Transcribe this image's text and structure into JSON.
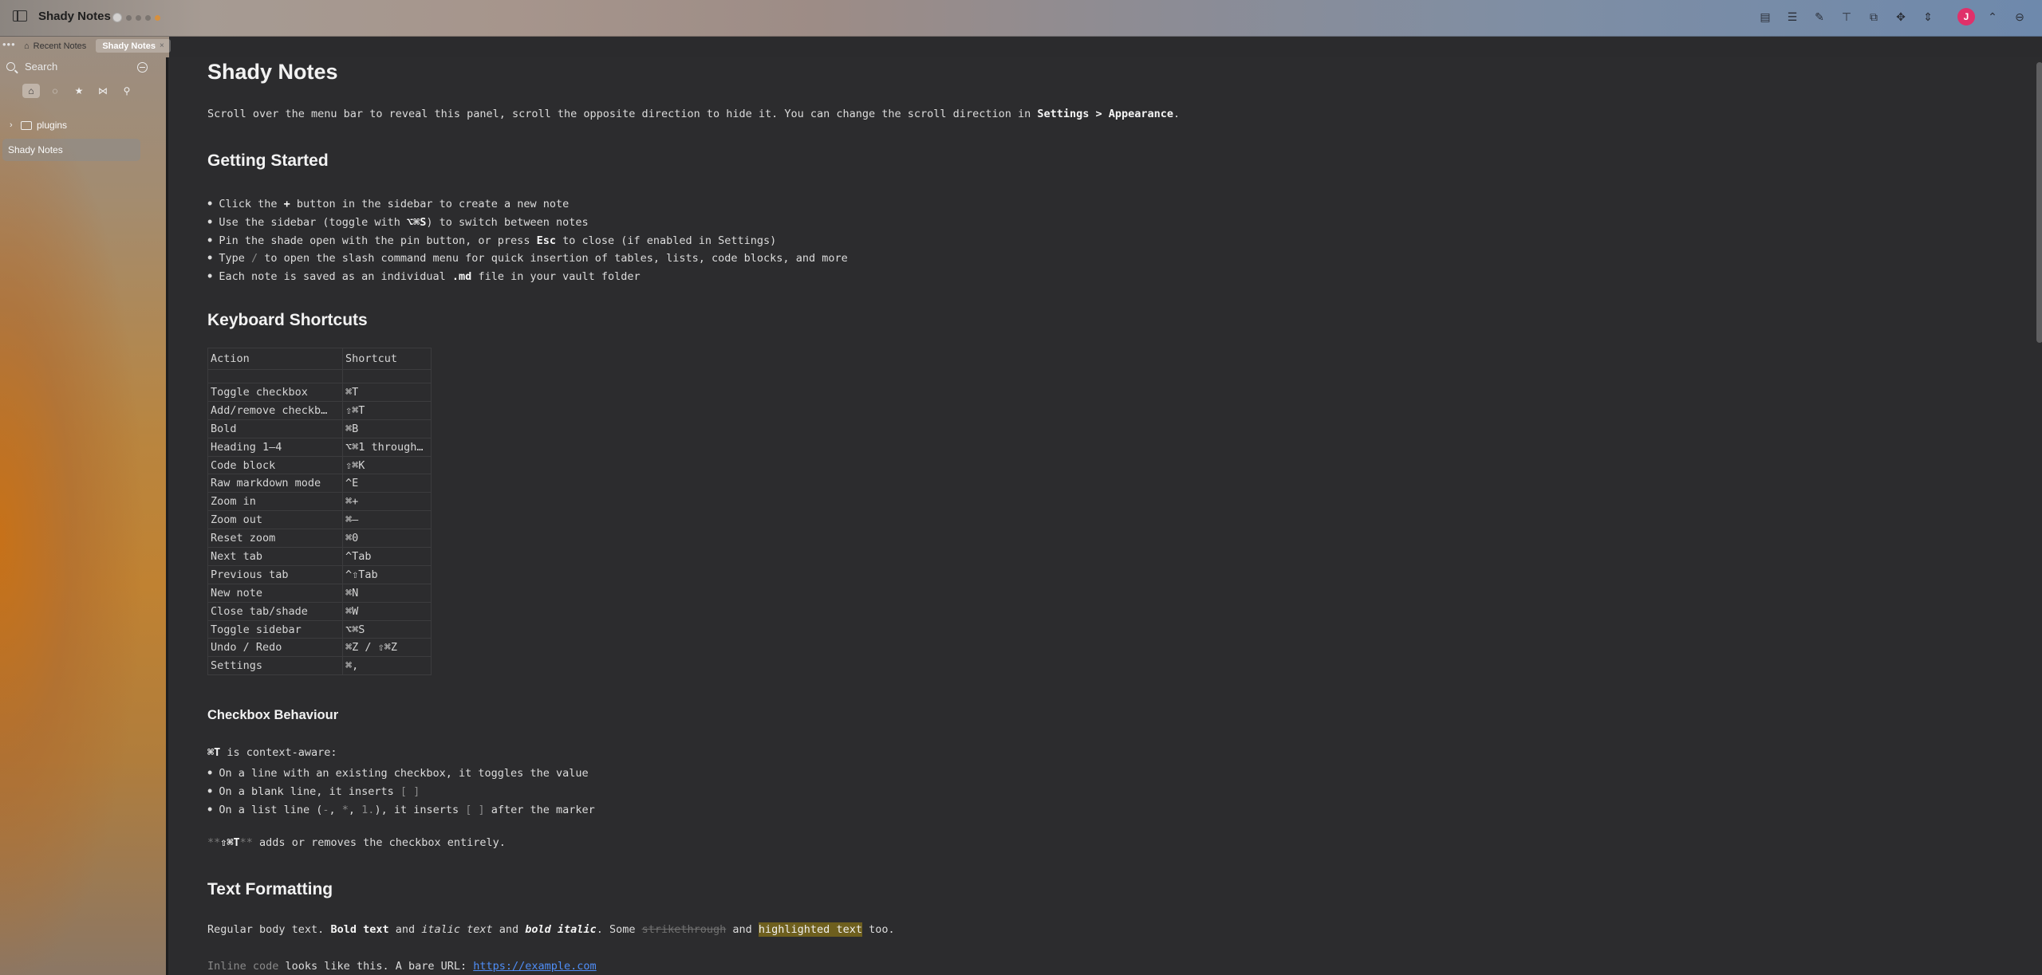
{
  "window": {
    "title": "Shady Notes",
    "toolbar_icons": [
      "note-icon",
      "list-icon",
      "pencil-icon",
      "pin-icon",
      "export-icon",
      "move-icon",
      "expand-icon"
    ],
    "avatar_initial": "J",
    "right_icons": [
      "chevron-up-icon",
      "minus-circle-icon"
    ]
  },
  "tabs": [
    {
      "label": "Recent Notes",
      "active": false
    },
    {
      "label": "Shady Notes",
      "active": true
    }
  ],
  "sidebar": {
    "search_placeholder": "Search",
    "tree": [
      {
        "label": "plugins",
        "type": "folder"
      },
      {
        "label": "Shady Notes",
        "type": "note",
        "selected": true
      }
    ]
  },
  "note": {
    "title": "Shady Notes",
    "intro_pre": "Scroll over the menu bar to reveal this panel, scroll the opposite direction to hide it. You can change the scroll direction in ",
    "intro_bold": "Settings > Appearance",
    "intro_post": ".",
    "getting_started": {
      "heading": "Getting Started",
      "b1_pre": "Click the ",
      "b1_bold": "+",
      "b1_post": " button in the sidebar to create a new note",
      "b2_pre": "Use the sidebar (toggle with ",
      "b2_bold": "⌥⌘S",
      "b2_post": ") to switch between notes",
      "b3_pre": "Pin the shade open with the pin button, or press ",
      "b3_bold": "Esc",
      "b3_post": " to close (if enabled in Settings)",
      "b4_pre": "Type ",
      "b4_code": "/",
      "b4_post": " to open the slash command menu for quick insertion of tables, lists, code blocks, and more",
      "b5_pre": "Each note is saved as an individual ",
      "b5_bold": ".md",
      "b5_post": " file in your vault folder"
    },
    "shortcuts": {
      "heading": "Keyboard Shortcuts",
      "col_action": "Action",
      "col_shortcut": "Shortcut",
      "rows": [
        [
          "Toggle checkbox",
          "⌘T"
        ],
        [
          "Add/remove checkb…",
          "⇧⌘T"
        ],
        [
          "Bold",
          "⌘B"
        ],
        [
          "Heading 1–4",
          "⌥⌘1 through…"
        ],
        [
          "Code block",
          "⇧⌘K"
        ],
        [
          "Raw markdown mode",
          "^E"
        ],
        [
          "Zoom in",
          "⌘+"
        ],
        [
          "Zoom out",
          "⌘–"
        ],
        [
          "Reset zoom",
          "⌘0"
        ],
        [
          "Next tab",
          "^Tab"
        ],
        [
          "Previous tab",
          "^⇧Tab"
        ],
        [
          "New note",
          "⌘N"
        ],
        [
          "Close tab/shade",
          "⌘W"
        ],
        [
          "Toggle sidebar",
          "⌥⌘S"
        ],
        [
          "Undo / Redo",
          "⌘Z / ⇧⌘Z"
        ],
        [
          "Settings",
          "⌘,"
        ]
      ]
    },
    "checkbox": {
      "heading": "Checkbox Behaviour",
      "intro_bold": "⌘T",
      "intro_post": " is context-aware:",
      "b1": "On a line with an existing checkbox, it toggles the value",
      "b2_pre": "On a blank line, it inserts ",
      "b2_code": "[ ]",
      "b3_pre": "On a list line (",
      "b3_c1": "-",
      "b3_sep1": ", ",
      "b3_c2": "*",
      "b3_sep2": ", ",
      "b3_c3": "1.",
      "b3_mid": "), it inserts ",
      "b3_c4": "[ ]",
      "b3_post": " after the marker",
      "outro_mark1": "**",
      "outro_bold": "⇧⌘T",
      "outro_mark2": "**",
      "outro_post": " adds or removes the checkbox entirely."
    },
    "formatting": {
      "heading": "Text Formatting",
      "l1_a": "Regular body text. ",
      "l1_bold": "Bold text",
      "l1_b": " and ",
      "l1_italic": "italic text",
      "l1_c": " and ",
      "l1_bi": "bold italic",
      "l1_d": ". Some ",
      "l1_strike": "strikethrough",
      "l1_e": " and ",
      "l1_hl": "highlighted text",
      "l1_f": " too.",
      "l2_code": "Inline code",
      "l2_mid": " looks like this. A bare URL: ",
      "l2_link": "https://example.com"
    }
  }
}
